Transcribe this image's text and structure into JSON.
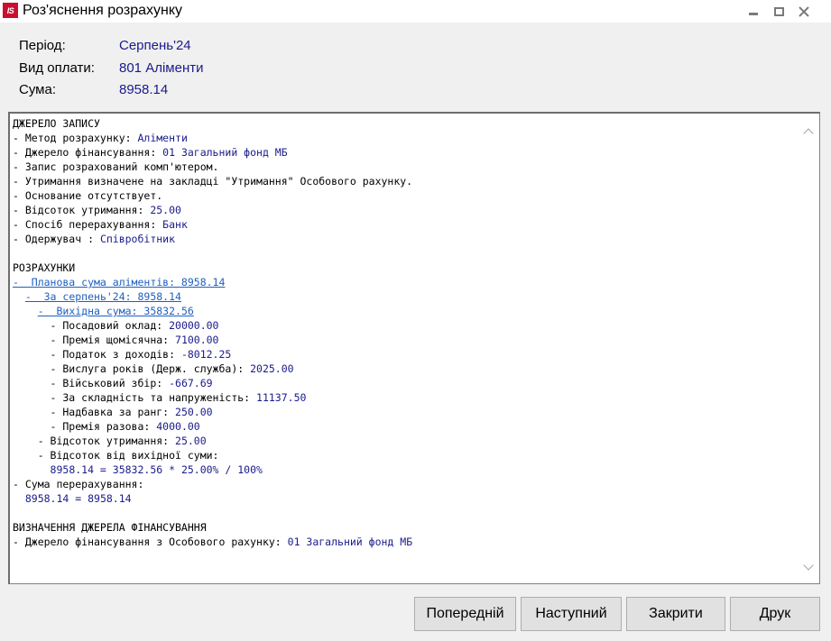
{
  "window": {
    "title": "Роз'яснення розрахунку",
    "app_icon_text": "IS"
  },
  "header": {
    "period_label": "Період:",
    "period_value": "Серпень'24",
    "payment_type_label": "Вид оплати:",
    "payment_type_value": "801 Аліменти",
    "sum_label": "Сума:",
    "sum_value": "8958.14"
  },
  "details": {
    "lines": [
      {
        "type": "text",
        "text": "ДЖЕРЕЛО ЗАПИСУ"
      },
      {
        "type": "kv",
        "prefix": "- Метод розрахунку: ",
        "value": "Аліменти"
      },
      {
        "type": "kv",
        "prefix": "- Джерело фінансування: ",
        "value": "01 Загальний фонд МБ"
      },
      {
        "type": "text",
        "text": "- Запис розрахований комп'ютером."
      },
      {
        "type": "text",
        "text": "- Утримання визначене на закладці \"Утримання\" Особового рахунку."
      },
      {
        "type": "text",
        "text": "- Основание отсутствует."
      },
      {
        "type": "kv",
        "prefix": "- Відсоток утримання: ",
        "value": "25.00"
      },
      {
        "type": "kv",
        "prefix": "- Спосіб перерахування: ",
        "value": "Банк"
      },
      {
        "type": "kv",
        "prefix": "- Одержувач : ",
        "value": "Співробітник"
      },
      {
        "type": "blank"
      },
      {
        "type": "text",
        "text": "РОЗРАХУНКИ"
      },
      {
        "type": "link",
        "indent": "",
        "text": "-  Планова сума аліментів: 8958.14"
      },
      {
        "type": "link",
        "indent": "  ",
        "text": "-  За серпень'24: 8958.14"
      },
      {
        "type": "link",
        "indent": "    ",
        "text": "-  Вихідна сума: 35832.56"
      },
      {
        "type": "kv",
        "prefix": "      - Посадовий оклад: ",
        "value": "20000.00"
      },
      {
        "type": "kv",
        "prefix": "      - Премія щомісячна: ",
        "value": "7100.00"
      },
      {
        "type": "kv",
        "prefix": "      - Податок з доходів: ",
        "value": "-8012.25"
      },
      {
        "type": "kv",
        "prefix": "      - Вислуга років (Держ. служба): ",
        "value": "2025.00"
      },
      {
        "type": "kv",
        "prefix": "      - Військовий збір: ",
        "value": "-667.69"
      },
      {
        "type": "kv",
        "prefix": "      - За складність та напруженість: ",
        "value": "11137.50"
      },
      {
        "type": "kv",
        "prefix": "      - Надбавка за ранг: ",
        "value": "250.00"
      },
      {
        "type": "kv",
        "prefix": "      - Премія разова: ",
        "value": "4000.00"
      },
      {
        "type": "kv",
        "prefix": "    - Відсоток утримання: ",
        "value": "25.00"
      },
      {
        "type": "text",
        "text": "    - Відсоток від вихідної суми:"
      },
      {
        "type": "kv",
        "prefix": "      ",
        "value": "8958.14 = 35832.56 * 25.00% / 100%"
      },
      {
        "type": "text",
        "text": "- Сума перерахування:"
      },
      {
        "type": "kv",
        "prefix": "  ",
        "value": "8958.14 = 8958.14"
      },
      {
        "type": "blank"
      },
      {
        "type": "text",
        "text": "ВИЗНАЧЕННЯ ДЖЕРЕЛА ФІНАНСУВАННЯ"
      },
      {
        "type": "kv",
        "prefix": "- Джерело фінансування з Особового рахунку: ",
        "value": "01 Загальний фонд МБ"
      }
    ]
  },
  "buttons": {
    "previous": "Попередній",
    "next": "Наступний",
    "close": "Закрити",
    "print": "Друк"
  },
  "colors": {
    "value_text": "#1a1a8c",
    "link_text": "#1f5fbf",
    "app_icon_bg": "#c8102e"
  }
}
